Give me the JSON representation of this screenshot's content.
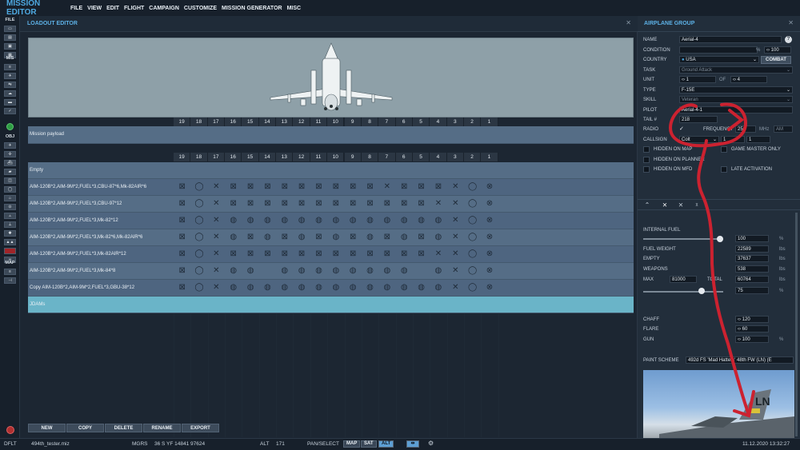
{
  "app": {
    "title": "MISSION EDITOR"
  },
  "menu": [
    "FILE",
    "VIEW",
    "EDIT",
    "FLIGHT",
    "CAMPAIGN",
    "CUSTOMIZE",
    "MISSION GENERATOR",
    "MISC"
  ],
  "toolbar": {
    "file_label": "FILE",
    "mis_label": "MIS",
    "obj_label": "OBJ",
    "map_label": "MAP"
  },
  "loadout": {
    "title": "LOADOUT EDITOR",
    "stations": [
      "19",
      "18",
      "17",
      "16",
      "15",
      "14",
      "13",
      "12",
      "11",
      "10",
      "9",
      "8",
      "7",
      "6",
      "5",
      "4",
      "3",
      "2",
      "1"
    ],
    "mission_payload_label": "Mission payload",
    "rows": [
      {
        "label": "Empty",
        "marks": ""
      },
      {
        "label": "AIM-120B*2,AIM-9M*2,FUEL*3,CBU-87*6,Mk-82AIR*6",
        "marks": "tcxtttttttttxtttxcn"
      },
      {
        "label": "AIM-120B*2,AIM-9M*2,FUEL*3,CBU-97*12",
        "marks": "tcxttttttttttttxxcn"
      },
      {
        "label": "AIM-120B*2,AIM-9M*2,FUEL*3,Mk-82*12",
        "marks": "tcxbbbbbbbbbbbbbxcn"
      },
      {
        "label": "AIM-120B*2,AIM-9M*2,FUEL*3,Mk-82*6,Mk-82AIR*6",
        "marks": "tcxbtbtbtbtbtbtbxcn"
      },
      {
        "label": "AIM-120B*2,AIM-9M*2,FUEL*3,Mk-82AIR*12",
        "marks": "tcxttttttttttttxxcn"
      },
      {
        "label": "AIM-120B*2,AIM-9M*2,FUEL*3,Mk-84*8",
        "marks": "tcxbb bbbbbbbb bxcn"
      },
      {
        "label": "Copy AIM-120B*2,AIM-9M*2,FUEL*3,GBU-38*12",
        "marks": "tcxbbbbbbbbbbbbbxcn"
      },
      {
        "label": "JDAMs",
        "marks": ""
      }
    ],
    "buttons": {
      "new": "NEW",
      "copy": "COPY",
      "delete": "DELETE",
      "rename": "RENAME",
      "export": "EXPORT"
    }
  },
  "group": {
    "title": "AIRPLANE GROUP",
    "name_label": "NAME",
    "name": "Aerial-4",
    "condition_label": "CONDITION",
    "condition": "100",
    "condition_unit": "%",
    "country_label": "COUNTRY",
    "country": "USA",
    "combat_label": "COMBAT",
    "task_label": "TASK",
    "task": "Ground Attack",
    "unit_label": "UNIT",
    "unit": "1",
    "unit_of": "OF",
    "unit_total": "4",
    "type_label": "TYPE",
    "type": "F-15E",
    "skill_label": "SKILL",
    "skill": "Veteran",
    "pilot_label": "PILOT",
    "pilot": "Aerial-4-1",
    "tail_label": "TAIL #",
    "tail": "218",
    "radio_label": "RADIO",
    "frequency_label": "FREQUENCY",
    "frequency": "251",
    "freq_unit": "MHz",
    "modulation": "AM",
    "callsign_label": "CALLSIGN",
    "callsign": "Colt",
    "callsign_n1": "1",
    "callsign_n2": "1",
    "checks": {
      "hidden_map": "HIDDEN ON MAP",
      "gm_only": "GAME MASTER ONLY",
      "hidden_planner": "HIDDEN ON PLANNER",
      "hidden_mfd": "HIDDEN ON MFD",
      "late": "LATE ACTIVATION"
    },
    "payload": {
      "internal_fuel_label": "INTERNAL FUEL",
      "internal_fuel": "100",
      "internal_fuel_unit": "%",
      "fuel_weight_label": "FUEL WEIGHT",
      "fuel_weight": "22589",
      "empty_label": "EMPTY",
      "empty": "37637",
      "weapons_label": "WEAPONS",
      "weapons": "538",
      "max_label": "MAX",
      "max": "81000",
      "total_label": "TOTAL",
      "total": "60764",
      "load_pct": "75",
      "load_unit": "%",
      "lbs": "lbs",
      "chaff_label": "CHAFF",
      "chaff": "120",
      "flare_label": "FLARE",
      "flare": "60",
      "gun_label": "GUN",
      "gun": "100",
      "gun_unit": "%",
      "paint_label": "PAINT SCHEME",
      "paint": "492d FS 'Mad Hatters' 48th FW (LN) (E"
    }
  },
  "status": {
    "mode": "DFLT",
    "file": "494th_tester.miz",
    "coord_label": "MGRS",
    "coord": "36 S YF 14841 97624",
    "alt_label": "ALT",
    "alt": "171",
    "pan": "PAN/SELECT",
    "map": "MAP",
    "sat": "SAT",
    "alt_btn": "ALT",
    "datetime": "11.12.2020 13:32:27"
  },
  "colors": {
    "accent": "#5db1e6",
    "annotation": "#cc2230",
    "selected_row": "#6ab4c8"
  }
}
